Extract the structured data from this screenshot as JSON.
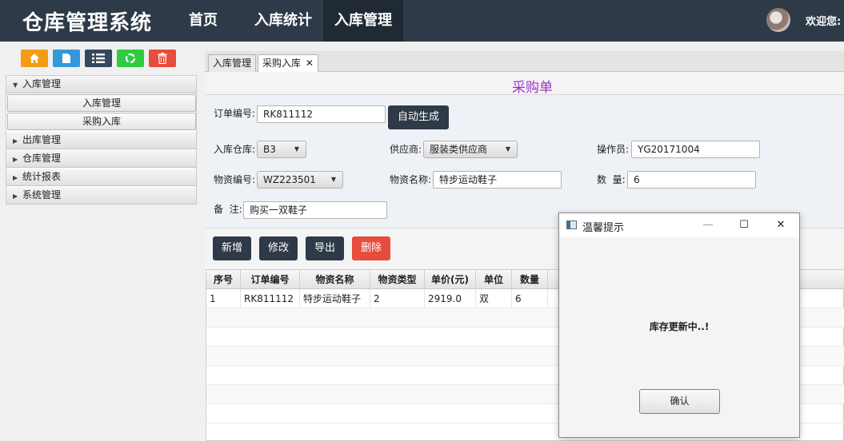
{
  "header": {
    "app_title": "仓库管理系统",
    "nav": [
      "首页",
      "入库统计",
      "入库管理"
    ],
    "welcome": "欢迎您:"
  },
  "toolbar": {
    "buttons": [
      {
        "icon": "home-icon",
        "color": "#f39c12"
      },
      {
        "icon": "document-icon",
        "color": "#3498db"
      },
      {
        "icon": "list-icon",
        "color": "#34495e"
      },
      {
        "icon": "recycle-icon",
        "color": "#2ecc40"
      },
      {
        "icon": "trash-icon",
        "color": "#e74c3c"
      }
    ]
  },
  "sidebar": {
    "groups": [
      {
        "label": "入库管理",
        "expanded": true,
        "items": [
          "入库管理",
          "采购入库"
        ]
      },
      {
        "label": "出库管理",
        "expanded": false
      },
      {
        "label": "仓库管理",
        "expanded": false
      },
      {
        "label": "统计报表",
        "expanded": false
      },
      {
        "label": "系统管理",
        "expanded": false
      }
    ]
  },
  "tabs": [
    "入库管理",
    "采购入库"
  ],
  "form": {
    "title": "采购单",
    "order_no_label": "订单编号:",
    "order_no_value": "RK811112",
    "auto_gen_label": "自动生成",
    "warehouse_label": "入库仓库:",
    "warehouse_value": "B3",
    "supplier_label": "供应商:",
    "supplier_value": "服装类供应商",
    "operator_label": "操作员:",
    "operator_value": "YG20171004",
    "material_no_label": "物资编号:",
    "material_no_value": "WZ223501",
    "material_name_label": "物资名称:",
    "material_name_value": "特步运动鞋子",
    "quantity_label": "数  量:",
    "quantity_value": "6",
    "remark_label": "备  注:",
    "remark_value": "购买一双鞋子"
  },
  "actions": {
    "add": "新增",
    "edit": "修改",
    "export": "导出",
    "delete": "删除"
  },
  "table": {
    "columns": [
      "序号",
      "订单编号",
      "物资名称",
      "物资类型",
      "单价(元)",
      "单位",
      "数量"
    ],
    "rows": [
      [
        "1",
        "RK811112",
        "特步运动鞋子",
        "2",
        "2919.0",
        "双",
        "6"
      ]
    ]
  },
  "dialog": {
    "title": "温馨提示",
    "message": "库存更新中..!",
    "confirm": "确认",
    "min_glyph": "—",
    "max_glyph": "☐",
    "close_glyph": "✕"
  }
}
